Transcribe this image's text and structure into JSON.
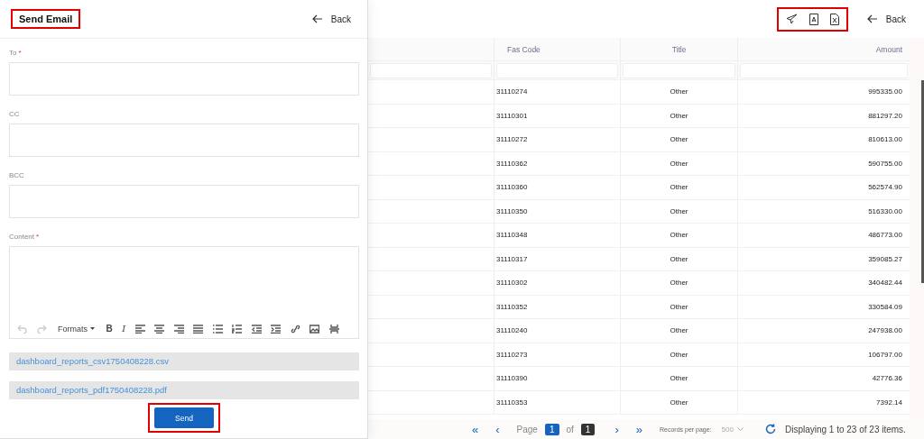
{
  "drawer": {
    "title": {
      "text": "Send Email",
      "highlighted": true
    },
    "back": "Back",
    "required_marker": "*",
    "fields": [
      {
        "label": "To",
        "required": true,
        "kind": "input"
      },
      {
        "label": "CC",
        "required": false,
        "kind": "input"
      },
      {
        "label": "BCC",
        "required": false,
        "kind": "input"
      },
      {
        "label": "Content",
        "required": true,
        "kind": "editor"
      }
    ],
    "toolbar": [
      {
        "kind": "undo",
        "disabled": true
      },
      {
        "kind": "redo",
        "disabled": true
      },
      {
        "kind": "formats",
        "label": "Formats",
        "disabled": false
      },
      {
        "kind": "bold",
        "label": "B",
        "disabled": false
      },
      {
        "kind": "italic",
        "label": "I",
        "disabled": false
      },
      {
        "kind": "align-left",
        "disabled": false
      },
      {
        "kind": "align-center",
        "disabled": false
      },
      {
        "kind": "align-right",
        "disabled": false
      },
      {
        "kind": "justify",
        "disabled": false
      },
      {
        "kind": "bullets",
        "disabled": false
      },
      {
        "kind": "numbers",
        "disabled": false
      },
      {
        "kind": "outdent",
        "disabled": false
      },
      {
        "kind": "indent",
        "disabled": false
      },
      {
        "kind": "link",
        "disabled": false
      },
      {
        "kind": "image",
        "disabled": false
      },
      {
        "kind": "pagebreak",
        "disabled": false
      }
    ],
    "attachments": [
      "dashboard_reports_csv1750408228.csv",
      "dashboard_reports_pdf1750408228.pdf"
    ],
    "send": {
      "label": "Send",
      "highlighted": true
    }
  },
  "header": {
    "actions": {
      "highlighted": true,
      "items": [
        {
          "kind": "send"
        },
        {
          "kind": "pdf"
        },
        {
          "kind": "excel"
        }
      ]
    },
    "back": "Back"
  },
  "table": {
    "columns": [
      "Fas Code",
      "Title",
      "Amount"
    ],
    "rows": [
      [
        "31110274",
        "Other",
        "995335.00"
      ],
      [
        "31110301",
        "Other",
        "881297.20"
      ],
      [
        "31110272",
        "Other",
        "810613.00"
      ],
      [
        "31110362",
        "Other",
        "590755.00"
      ],
      [
        "31110360",
        "Other",
        "562574.90"
      ],
      [
        "31110350",
        "Other",
        "516330.00"
      ],
      [
        "31110348",
        "Other",
        "486773.00"
      ],
      [
        "31110317",
        "Other",
        "359085.27"
      ],
      [
        "31110302",
        "Other",
        "340482.44"
      ],
      [
        "31110352",
        "Other",
        "330584.09"
      ],
      [
        "31110240",
        "Other",
        "247938.00"
      ],
      [
        "31110273",
        "Other",
        "106797.00"
      ],
      [
        "31110390",
        "Other",
        "42776.36"
      ],
      [
        "31110353",
        "Other",
        "7392.14"
      ]
    ]
  },
  "pager": {
    "first": "«",
    "prev": "‹",
    "page_label": "Page",
    "page": "1",
    "of": "of",
    "total": "1",
    "next": "›",
    "last": "»",
    "per_page_label": "Records per page:",
    "per_page": "500",
    "summary": "Displaying 1 to 23 of 23 items."
  }
}
